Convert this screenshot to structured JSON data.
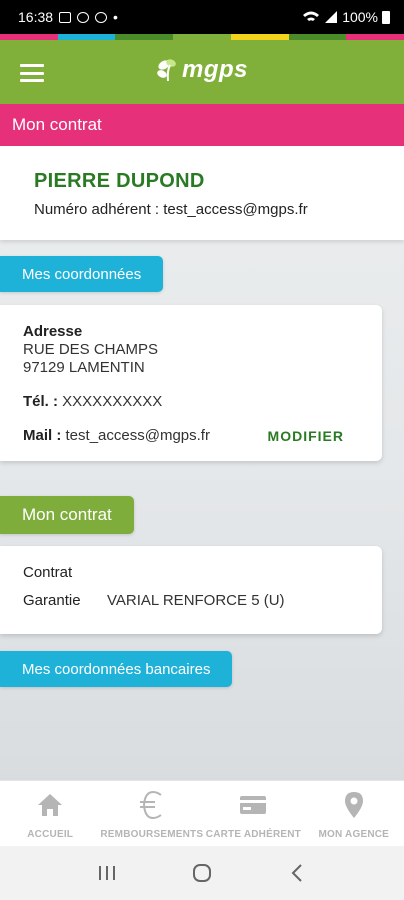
{
  "status_bar": {
    "time": "16:38",
    "battery": "100%"
  },
  "strip_colors": [
    "#e6317a",
    "#1fb2d9",
    "#4a8c2a",
    "#80b03a",
    "#f2d21a",
    "#4a8c2a",
    "#e6317a"
  ],
  "header": {
    "logo_text": "mgps",
    "background": "#80b03a"
  },
  "section": {
    "title": "Mon contrat"
  },
  "member": {
    "name": "PIERRE DUPOND",
    "number_label": "Numéro adhérent : ",
    "number_value": "test_access@mgps.fr"
  },
  "coordinates": {
    "tab_label": "Mes coordonnées",
    "address_title": "Adresse",
    "address_line1": "RUE DES CHAMPS",
    "address_line2": "97129 LAMENTIN",
    "tel_label": "Tél. : ",
    "tel_value": "XXXXXXXXXX",
    "mail_label": "Mail : ",
    "mail_value": "test_access@mgps.fr",
    "modify_label": "MODIFIER"
  },
  "contract": {
    "tab_label": "Mon contrat",
    "contract_label": "Contrat",
    "guarantee_label": "Garantie",
    "guarantee_value": "VARIAL RENFORCE 5 (U)"
  },
  "bank": {
    "tab_label": "Mes coordonnées bancaires"
  },
  "bottom_nav": {
    "items": [
      {
        "label": "ACCUEIL",
        "icon": "home-icon"
      },
      {
        "label": "REMBOURSEMENTS",
        "icon": "euro-icon"
      },
      {
        "label": "CARTE ADHÉRENT",
        "icon": "card-icon"
      },
      {
        "label": "MON AGENCE",
        "icon": "location-pin-icon"
      }
    ]
  },
  "colors": {
    "green_dark": "#2a7a24",
    "green": "#80b03a",
    "pink": "#e6317a",
    "blue": "#1fb2d9"
  }
}
